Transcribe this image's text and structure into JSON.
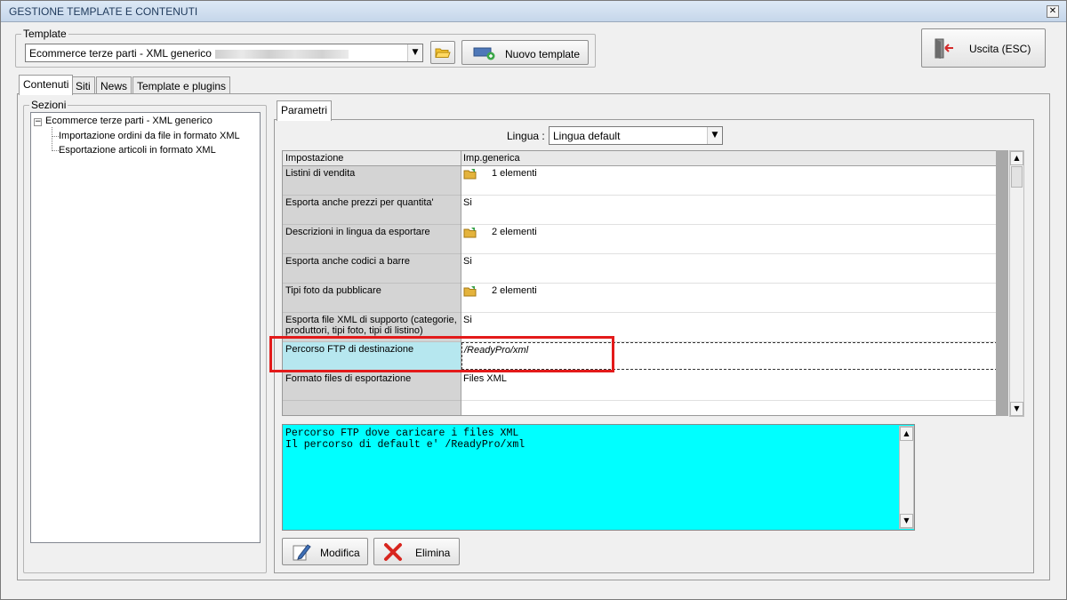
{
  "window": {
    "title": "GESTIONE TEMPLATE E CONTENUTI",
    "close_glyph": "✕"
  },
  "template_group": {
    "legend": "Template",
    "selected_template": "Ecommerce terze parti - XML generico",
    "dropdown_glyph": "▼",
    "new_button_label": "Nuovo template"
  },
  "exit_button_label": "Uscita (ESC)",
  "main_tabs": [
    "Contenuti",
    "Siti",
    "News",
    "Template e plugins"
  ],
  "sections": {
    "legend": "Sezioni",
    "root": "Ecommerce terze parti - XML generico",
    "expander_glyph": "−",
    "children": [
      "Importazione ordini da file in formato XML",
      "Esportazione articoli in formato XML"
    ]
  },
  "params_tab": "Parametri",
  "language": {
    "label": "Lingua :",
    "value": "Lingua default"
  },
  "grid": {
    "headers": [
      "Impostazione",
      "Imp.generica"
    ],
    "rows": [
      {
        "name": "Listini di vendita",
        "value": "1 elementi",
        "icon": "folder-icon"
      },
      {
        "name": "Esporta anche prezzi per quantita'",
        "value": "Si"
      },
      {
        "name": "Descrizioni in lingua da esportare",
        "value": "2 elementi",
        "icon": "folder-icon"
      },
      {
        "name": "Esporta anche codici a barre",
        "value": "Si"
      },
      {
        "name": "Tipi foto da pubblicare",
        "value": "2 elementi",
        "icon": "folder-icon"
      },
      {
        "name": "Esporta file XML di supporto (categorie, produttori, tipi foto, tipi di listino)",
        "value": "Si"
      },
      {
        "name": "Percorso FTP di destinazione",
        "value": "/ReadyPro/xml",
        "selected": true
      },
      {
        "name": "Formato files di esportazione",
        "value": "Files XML"
      }
    ]
  },
  "description": {
    "lines": [
      "Percorso FTP dove caricare i files XML",
      "Il percorso di default e' /ReadyPro/xml"
    ]
  },
  "bottom_buttons": {
    "edit_label": "Modifica",
    "delete_label": "Elimina"
  },
  "scroll_glyphs": {
    "up": "▲",
    "down": "▼"
  },
  "colors": {
    "selected_row": "#b6e7ef",
    "description_bg": "#00ffff",
    "highlight": "#e31a1a"
  }
}
